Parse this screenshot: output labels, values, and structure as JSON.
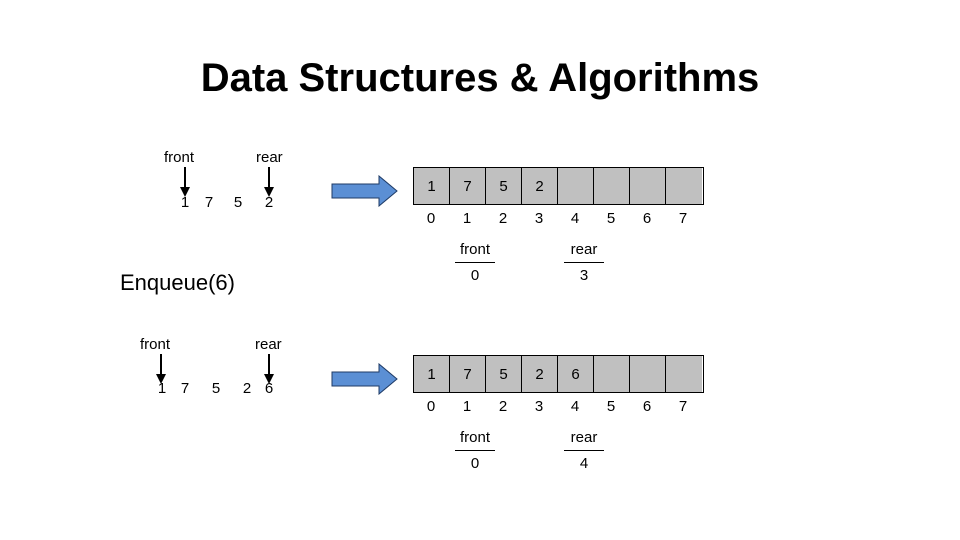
{
  "title": "Data Structures & Algorithms",
  "operation": "Enqueue(6)",
  "colors": {
    "arrow_fill": "#5b8fd4",
    "cell_fill": "#c0c0c0"
  },
  "diagrams": [
    {
      "logical": {
        "front_label": "front",
        "rear_label": "rear",
        "values": [
          "1",
          "7",
          "5",
          "2"
        ]
      },
      "array": {
        "cells": [
          "1",
          "7",
          "5",
          "2",
          "",
          "",
          "",
          ""
        ],
        "indices": [
          "0",
          "1",
          "2",
          "3",
          "4",
          "5",
          "6",
          "7"
        ]
      },
      "pointers": {
        "front": {
          "label": "front",
          "value": "0"
        },
        "rear": {
          "label": "rear",
          "value": "3"
        }
      }
    },
    {
      "logical": {
        "front_label": "front",
        "rear_label": "rear",
        "values": [
          "1",
          "7",
          "5",
          "2",
          "6"
        ]
      },
      "array": {
        "cells": [
          "1",
          "7",
          "5",
          "2",
          "6",
          "",
          "",
          ""
        ],
        "indices": [
          "0",
          "1",
          "2",
          "3",
          "4",
          "5",
          "6",
          "7"
        ]
      },
      "pointers": {
        "front": {
          "label": "front",
          "value": "0"
        },
        "rear": {
          "label": "rear",
          "value": "4"
        }
      }
    }
  ]
}
